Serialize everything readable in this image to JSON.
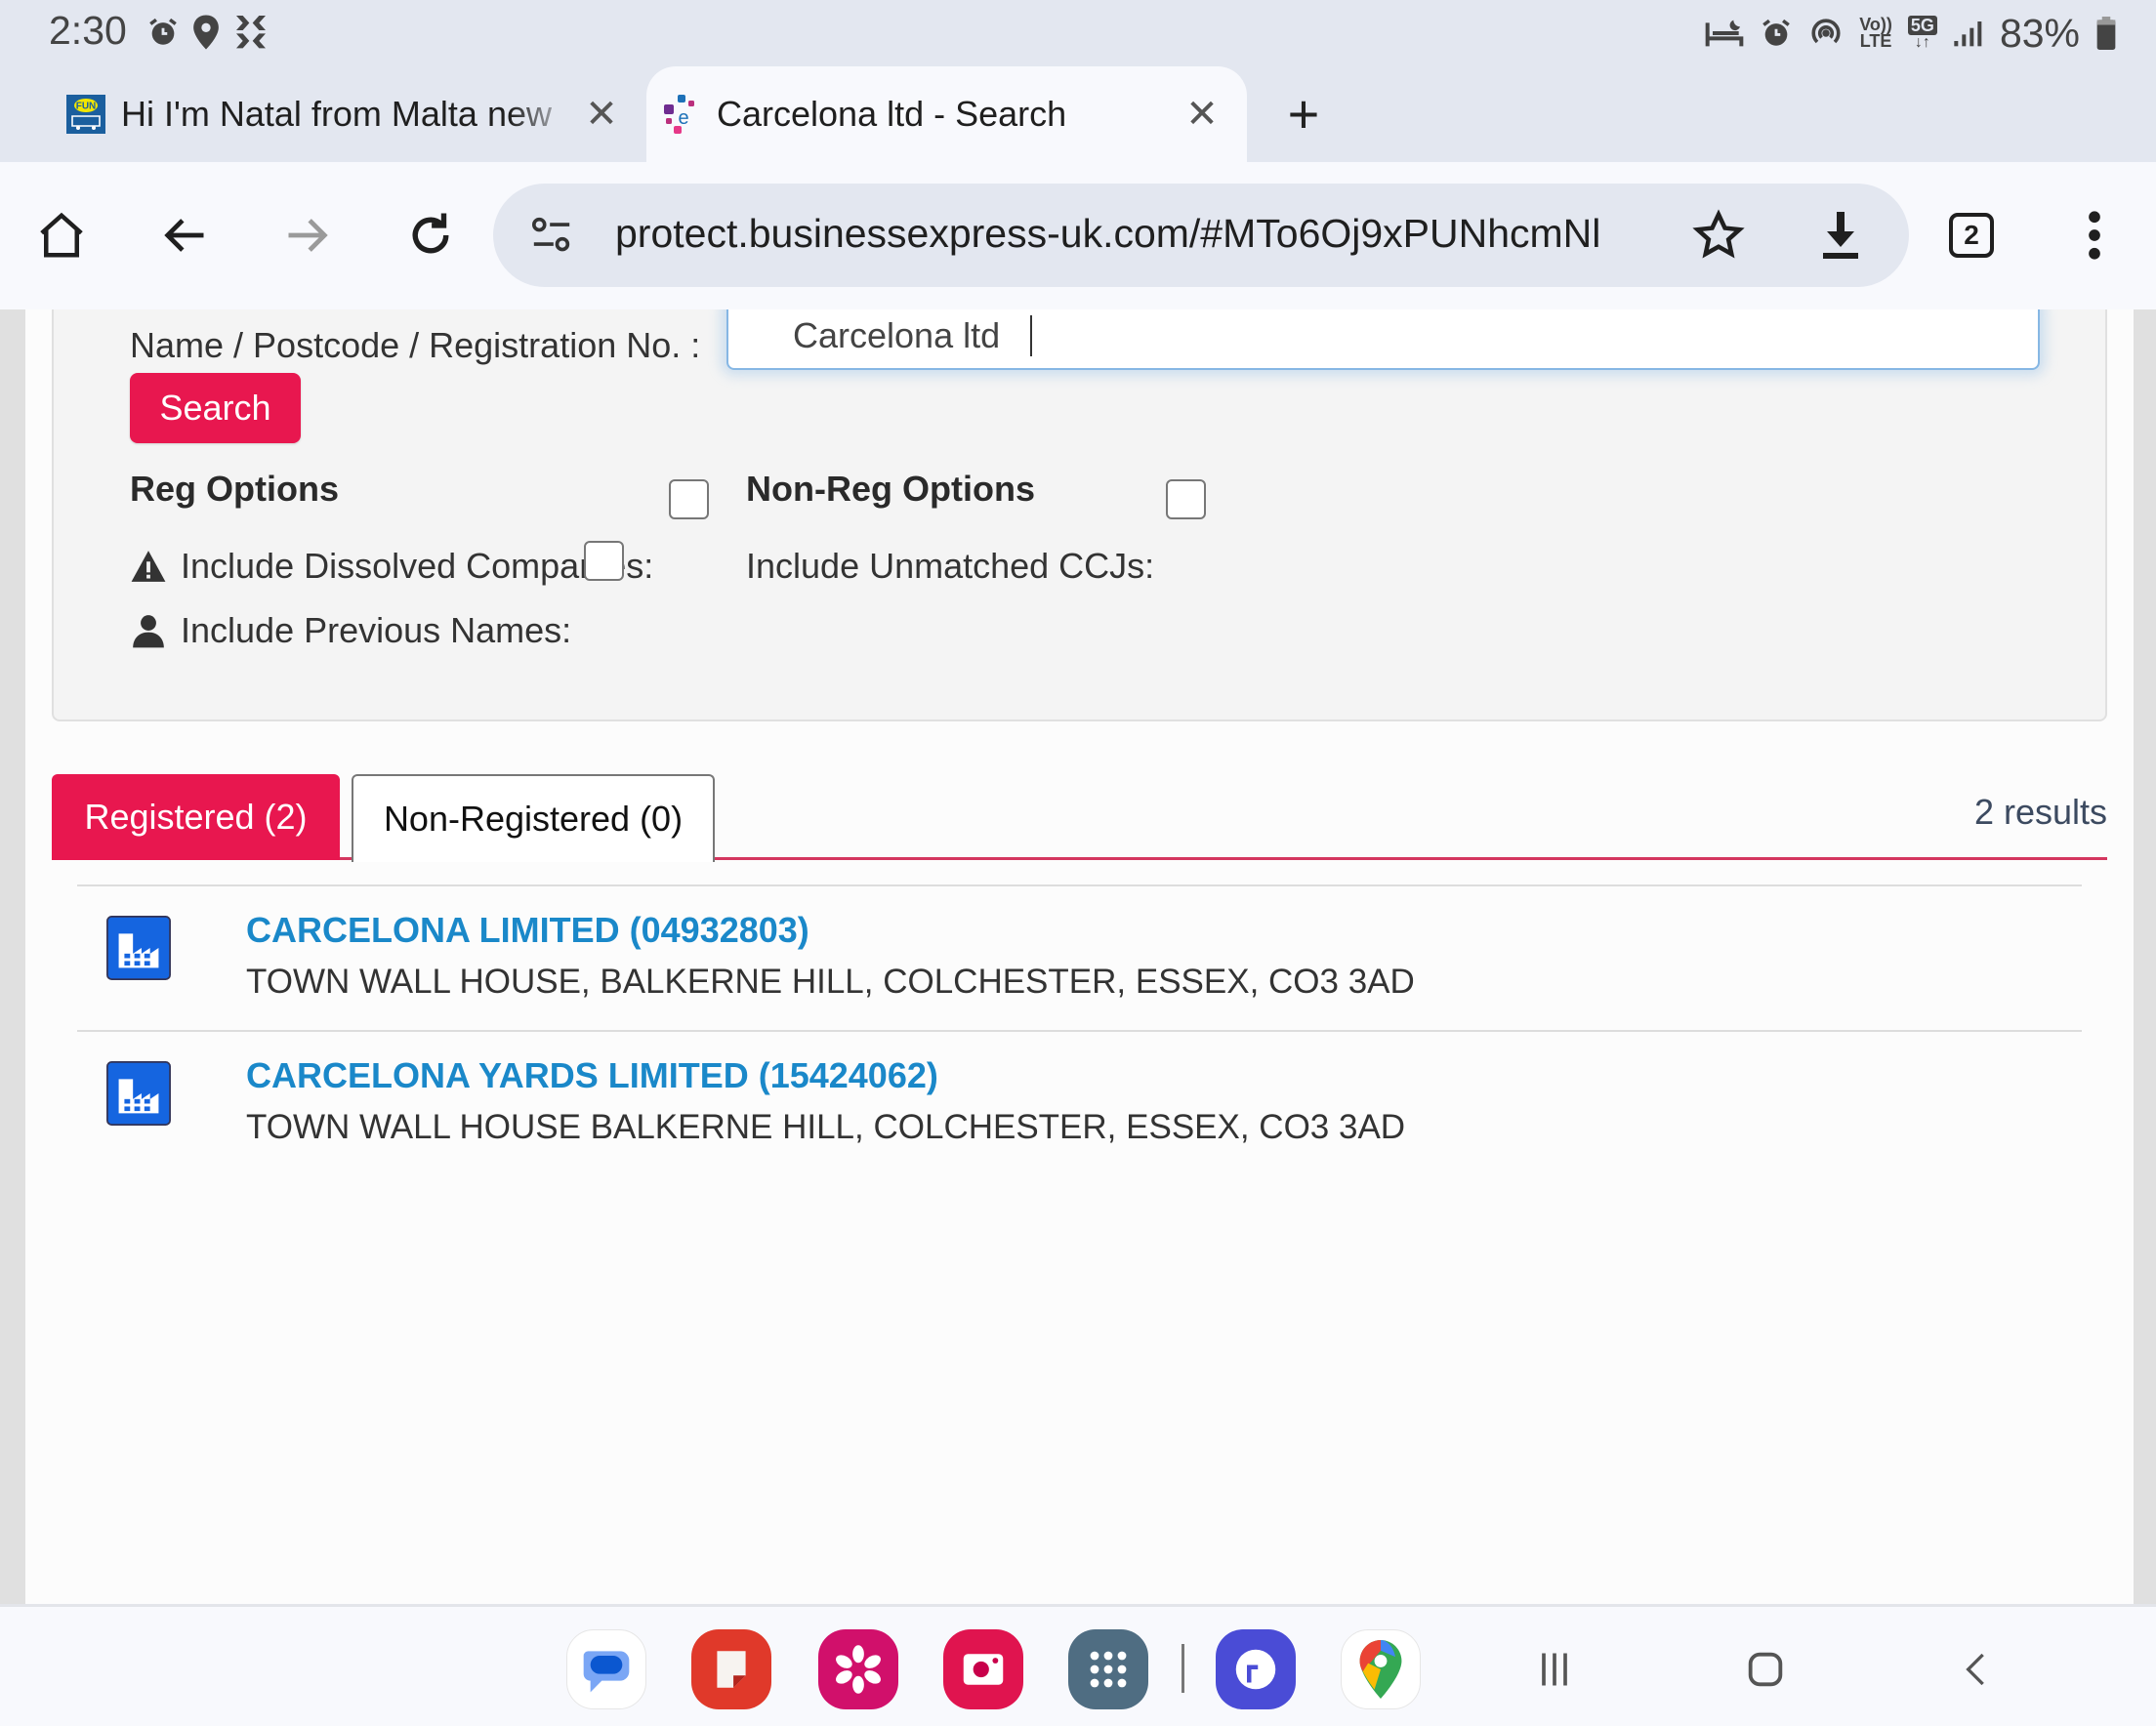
{
  "status_bar": {
    "time": "2:30",
    "left_icons": [
      "alarm-icon",
      "location-icon",
      "bank-app-icon"
    ],
    "right_icons": [
      "bedtime-icon",
      "alarm-icon",
      "hotspot-icon",
      "volte-icon",
      "5g-icon",
      "signal-icon"
    ],
    "volte_top": "Vo))",
    "volte_bottom": "LTE",
    "network": "5G",
    "battery": "83%"
  },
  "browser": {
    "tabs": [
      {
        "title": "Hi I'm Natal from Malta new",
        "favicon": "fun-campervan-favicon",
        "active": false
      },
      {
        "title": "Carcelona ltd - Search",
        "favicon": "experian-favicon",
        "active": true
      }
    ],
    "new_tab_label": "+",
    "close_label": "✕",
    "url": "protect.businessexpress-uk.com/#MTo6Oj9xPUNhcmNl",
    "tab_count": "2"
  },
  "search": {
    "label": "Name / Postcode / Registration No. :",
    "value": "Carcelona ltd",
    "button": "Search"
  },
  "options": {
    "reg_heading": "Reg Options",
    "nonreg_heading": "Non-Reg Options",
    "dissolved": {
      "label": "Include Dissolved Companies:",
      "checked": false
    },
    "previous_names": {
      "label": "Include Previous Names:",
      "checked": false
    },
    "unmatched_ccjs": {
      "label": "Include Unmatched CCJs:",
      "checked": false
    }
  },
  "results_tabs": {
    "registered": "Registered (2)",
    "non_registered": "Non-Registered (0)",
    "active": "registered",
    "count": "2 results"
  },
  "results": [
    {
      "name": "CARCELONA LIMITED (04932803)",
      "address": "TOWN WALL HOUSE, BALKERNE HILL, COLCHESTER, ESSEX, CO3 3AD"
    },
    {
      "name": "CARCELONA YARDS LIMITED (15424062)",
      "address": "TOWN WALL HOUSE BALKERNE HILL, COLCHESTER, ESSEX, CO3 3AD"
    }
  ],
  "colors": {
    "accent": "#e8174f",
    "link": "#1a88c9",
    "building_icon": "#1565e0"
  },
  "dock": [
    {
      "name": "messages-app"
    },
    {
      "name": "notes-app"
    },
    {
      "name": "flower-gallery-app"
    },
    {
      "name": "camera-app"
    },
    {
      "name": "app-drawer"
    },
    {
      "name": "music-app"
    },
    {
      "name": "maps-app"
    }
  ]
}
